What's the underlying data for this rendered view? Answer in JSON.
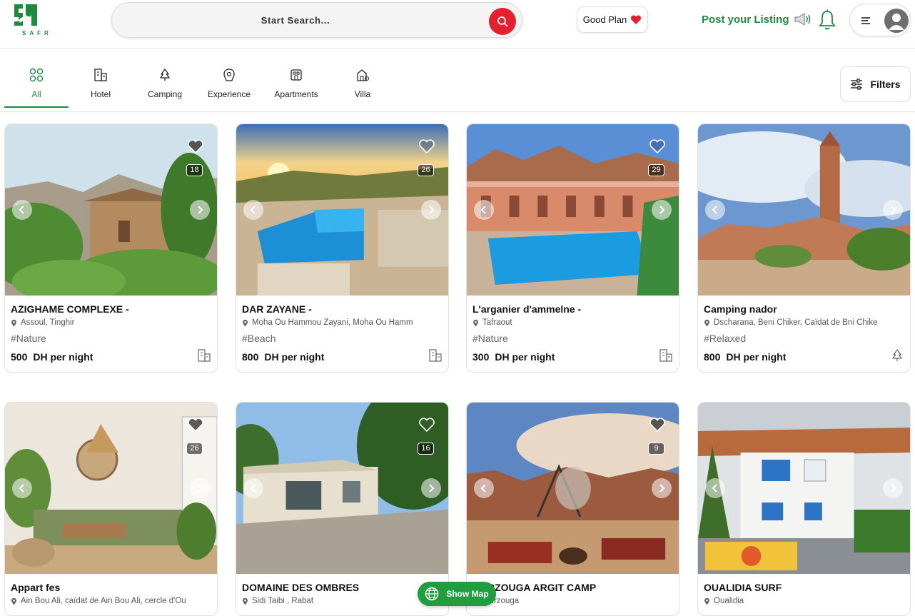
{
  "brand": {
    "logo_text": "SAFR",
    "accent": "#1f8a3e",
    "red": "#e5202e"
  },
  "header": {
    "search_label": "Start Search...",
    "good_plan_label": "Good Plan",
    "post_listing_label": "Post your Listing"
  },
  "categories": [
    {
      "label": "All",
      "icon": "grid-icon",
      "active": true
    },
    {
      "label": "Hotel",
      "icon": "hotel-icon"
    },
    {
      "label": "Camping",
      "icon": "tree-icon"
    },
    {
      "label": "Experience",
      "icon": "experience-icon"
    },
    {
      "label": "Apartments",
      "icon": "apartment-icon"
    },
    {
      "label": "Villa",
      "icon": "villa-icon"
    }
  ],
  "filters_label": "Filters",
  "listings": [
    {
      "title": "AZIGHAME COMPLEXE -",
      "location": "Assoul, Tinghir",
      "tag": "#Nature",
      "price": "500",
      "price_unit": "DH per night",
      "photo_count": "18",
      "type_icon": "hotel-icon",
      "heart_filled": true
    },
    {
      "title": "DAR ZAYANE -",
      "location": "Moha Ou Hammou Zayani, Moha Ou Hamm",
      "tag": "#Beach",
      "price": "800",
      "price_unit": "DH per night",
      "photo_count": "26",
      "type_icon": "hotel-icon",
      "heart_filled": false
    },
    {
      "title": "L'arganier d'ammelne -",
      "location": "Tafraout",
      "tag": "#Nature",
      "price": "300",
      "price_unit": "DH per night",
      "photo_count": "29",
      "type_icon": "hotel-icon",
      "heart_filled": false
    },
    {
      "title": "Camping nador",
      "location": "Dscharana, Beni Chiker, Caïdat de Bni Chike",
      "tag": "#Relaxed",
      "price": "800",
      "price_unit": "DH per night",
      "photo_count": "",
      "type_icon": "tree-icon",
      "heart_filled": false
    },
    {
      "title": "Appart fes",
      "location": "Ain Bou Ali, caïdat de Ain Bou Ali, cercle d'Ou",
      "photo_count": "26",
      "heart_filled": true
    },
    {
      "title": "DOMAINE DES OMBRES",
      "location": "Sidi Taibi , Rabat",
      "photo_count": "16",
      "heart_filled": false
    },
    {
      "title": "MERZOUGA ARGIT CAMP",
      "location": "Merzouga",
      "photo_count": "9",
      "heart_filled": true
    },
    {
      "title": "OUALIDIA SURF",
      "location": "Oualidia",
      "photo_count": "",
      "heart_filled": false
    }
  ],
  "show_map_label": "Show Map"
}
